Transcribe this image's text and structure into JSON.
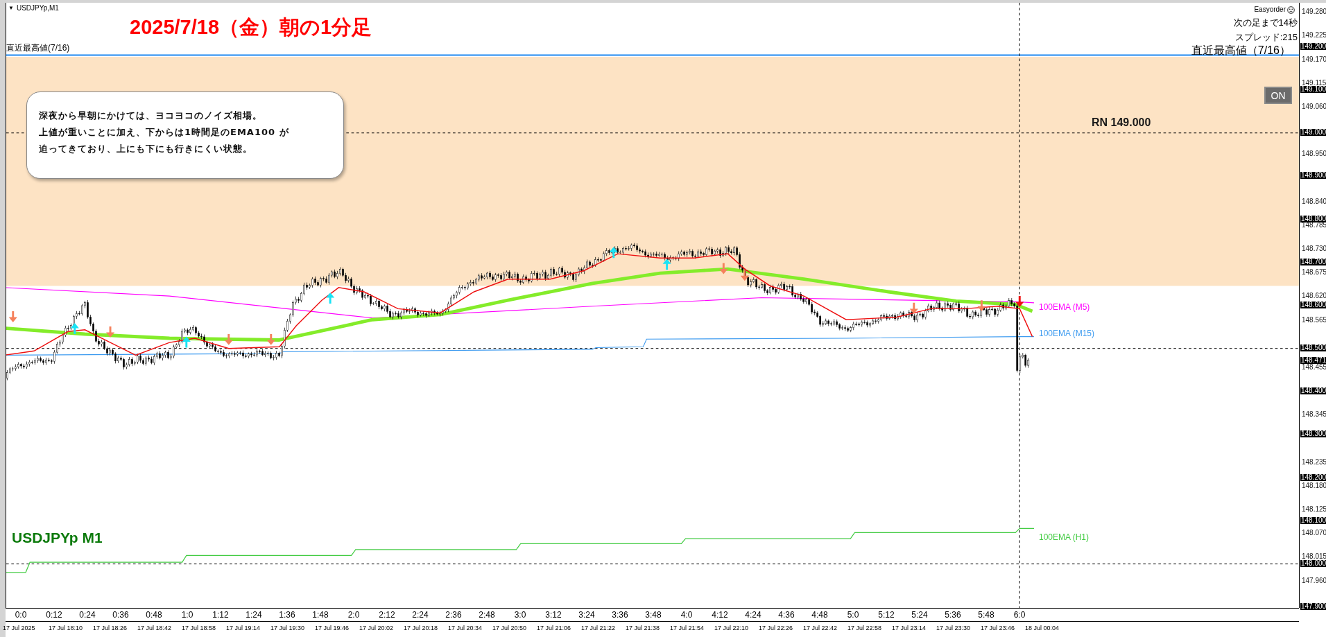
{
  "chart_header": {
    "menu_icon": "▼",
    "symbol": "USDJPYp,M1"
  },
  "title": "2025/7/18（金）朝の1分足",
  "level_line_left_label": "直近最高値(7/16)",
  "info_panel": {
    "ea_name": "Easyorder",
    "countdown": "次の足まで14秒",
    "spread": "スプレッド:215",
    "level_label": "直近最高値（7/16）"
  },
  "toggle_button": {
    "label": "ON"
  },
  "round_number_label": "RN 149.000",
  "note": {
    "lines": [
      "深夜から早朝にかけては、ヨコヨコのノイズ相場。",
      "上値が重いことに加え、下からは1時間足のEMA100 が",
      "迫ってきており、上にも下にも行きにくい状態。"
    ]
  },
  "ema_labels": [
    {
      "label": "100EMA (M5)",
      "color": "#ff00ff"
    },
    {
      "label": "100EMA (M15)",
      "color": "#3d9bf0"
    },
    {
      "label": "100EMA (H1)",
      "color": "#44cc44"
    }
  ],
  "symbol_watermark": "USDJPYp M1",
  "price_axis": [
    {
      "label": "149.280",
      "kind": "tick"
    },
    {
      "label": "149.225",
      "kind": "tick"
    },
    {
      "label": "149.200",
      "kind": "level"
    },
    {
      "label": "149.170",
      "kind": "tick"
    },
    {
      "label": "149.115",
      "kind": "tick"
    },
    {
      "label": "149.100",
      "kind": "level"
    },
    {
      "label": "149.060",
      "kind": "tick"
    },
    {
      "label": "149.000",
      "kind": "level"
    },
    {
      "label": "148.950",
      "kind": "tick"
    },
    {
      "label": "148.900",
      "kind": "level"
    },
    {
      "label": "148.840",
      "kind": "tick"
    },
    {
      "label": "148.800",
      "kind": "level"
    },
    {
      "label": "148.785",
      "kind": "tick"
    },
    {
      "label": "148.730",
      "kind": "tick"
    },
    {
      "label": "148.700",
      "kind": "level"
    },
    {
      "label": "148.675",
      "kind": "tick"
    },
    {
      "label": "148.620",
      "kind": "tick"
    },
    {
      "label": "148.600",
      "kind": "level"
    },
    {
      "label": "148.565",
      "kind": "tick"
    },
    {
      "label": "148.500",
      "kind": "level"
    },
    {
      "label": "148.471",
      "kind": "level"
    },
    {
      "label": "148.455",
      "kind": "tick"
    },
    {
      "label": "148.400",
      "kind": "level"
    },
    {
      "label": "148.345",
      "kind": "tick"
    },
    {
      "label": "148.300",
      "kind": "level"
    },
    {
      "label": "148.235",
      "kind": "tick"
    },
    {
      "label": "148.200",
      "kind": "level"
    },
    {
      "label": "148.180",
      "kind": "tick"
    },
    {
      "label": "148.125",
      "kind": "tick"
    },
    {
      "label": "148.100",
      "kind": "level"
    },
    {
      "label": "148.070",
      "kind": "tick"
    },
    {
      "label": "148.015",
      "kind": "tick"
    },
    {
      "label": "148.000",
      "kind": "level"
    },
    {
      "label": "147.960",
      "kind": "tick"
    },
    {
      "label": "147.900",
      "kind": "level"
    }
  ],
  "time_axis": [
    "0:0",
    "0:12",
    "0:24",
    "0:36",
    "0:48",
    "1:0",
    "1:12",
    "1:24",
    "1:36",
    "1:48",
    "2:0",
    "2:12",
    "2:24",
    "2:36",
    "2:48",
    "3:0",
    "3:12",
    "3:24",
    "3:36",
    "3:48",
    "4:0",
    "4:12",
    "4:24",
    "4:36",
    "4:48",
    "5:0",
    "5:12",
    "5:24",
    "5:36",
    "5:48",
    "6:0"
  ],
  "date_axis": [
    "17 Jul 2025",
    "17 Jul 18:10",
    "17 Jul 18:26",
    "17 Jul 18:42",
    "17 Jul 18:58",
    "17 Jul 19:14",
    "17 Jul 19:30",
    "17 Jul 19:46",
    "17 Jul 20:02",
    "17 Jul 20:18",
    "17 Jul 20:34",
    "17 Jul 20:50",
    "17 Jul 21:06",
    "17 Jul 21:22",
    "17 Jul 21:38",
    "17 Jul 21:54",
    "17 Jul 22:10",
    "17 Jul 22:26",
    "17 Jul 22:42",
    "17 Jul 22:58",
    "17 Jul 23:14",
    "17 Jul 23:30",
    "17 Jul 23:46",
    "18 Jul 00:04"
  ]
}
